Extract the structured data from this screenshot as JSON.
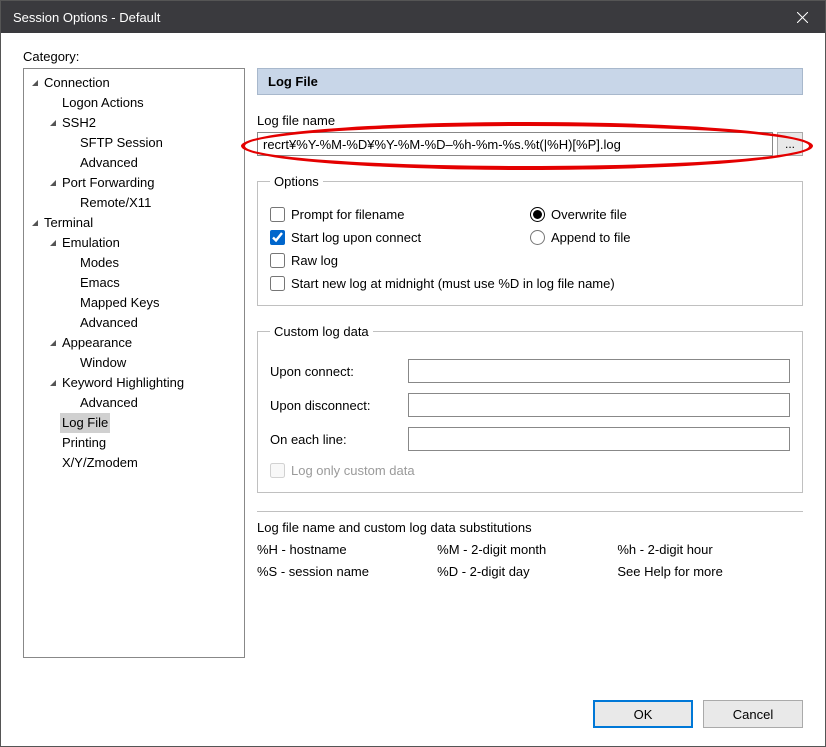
{
  "window": {
    "title": "Session Options - Default"
  },
  "category_label": "Category:",
  "tree": [
    {
      "label": "Connection",
      "depth": 0,
      "exp": "v"
    },
    {
      "label": "Logon Actions",
      "depth": 1,
      "exp": ""
    },
    {
      "label": "SSH2",
      "depth": 1,
      "exp": "v"
    },
    {
      "label": "SFTP Session",
      "depth": 2,
      "exp": ""
    },
    {
      "label": "Advanced",
      "depth": 2,
      "exp": ""
    },
    {
      "label": "Port Forwarding",
      "depth": 1,
      "exp": "v"
    },
    {
      "label": "Remote/X11",
      "depth": 2,
      "exp": ""
    },
    {
      "label": "Terminal",
      "depth": 0,
      "exp": "v"
    },
    {
      "label": "Emulation",
      "depth": 1,
      "exp": "v"
    },
    {
      "label": "Modes",
      "depth": 2,
      "exp": ""
    },
    {
      "label": "Emacs",
      "depth": 2,
      "exp": ""
    },
    {
      "label": "Mapped Keys",
      "depth": 2,
      "exp": ""
    },
    {
      "label": "Advanced",
      "depth": 2,
      "exp": ""
    },
    {
      "label": "Appearance",
      "depth": 1,
      "exp": "v"
    },
    {
      "label": "Window",
      "depth": 2,
      "exp": ""
    },
    {
      "label": "Keyword Highlighting",
      "depth": 1,
      "exp": "v"
    },
    {
      "label": "Advanced",
      "depth": 2,
      "exp": ""
    },
    {
      "label": "Log File",
      "depth": 1,
      "exp": "",
      "selected": true
    },
    {
      "label": "Printing",
      "depth": 1,
      "exp": ""
    },
    {
      "label": "X/Y/Zmodem",
      "depth": 1,
      "exp": ""
    }
  ],
  "panel": {
    "heading": "Log File",
    "logfile_label": "Log file name",
    "logfile_value": "recrt¥%Y-%M-%D¥%Y-%M-%D–%h-%m-%s.%t(|%H)[%P].log",
    "browse_label": "...",
    "options": {
      "legend": "Options",
      "prompt": "Prompt for filename",
      "overwrite": "Overwrite file",
      "start_on_connect": "Start log upon connect",
      "append": "Append to file",
      "raw": "Raw log",
      "midnight": "Start new log at midnight (must use %D in log file name)"
    },
    "custom": {
      "legend": "Custom log data",
      "upon_connect": "Upon connect:",
      "upon_disconnect": "Upon disconnect:",
      "each_line": "On each line:",
      "only_custom": "Log only custom data"
    },
    "subs": {
      "title": "Log file name and custom log data substitutions",
      "c1a": "%H - hostname",
      "c2a": "%M - 2-digit month",
      "c3a": "%h - 2-digit hour",
      "c1b": "%S - session name",
      "c2b": "%D - 2-digit day",
      "c3b": "See Help for more"
    }
  },
  "buttons": {
    "ok": "OK",
    "cancel": "Cancel"
  }
}
